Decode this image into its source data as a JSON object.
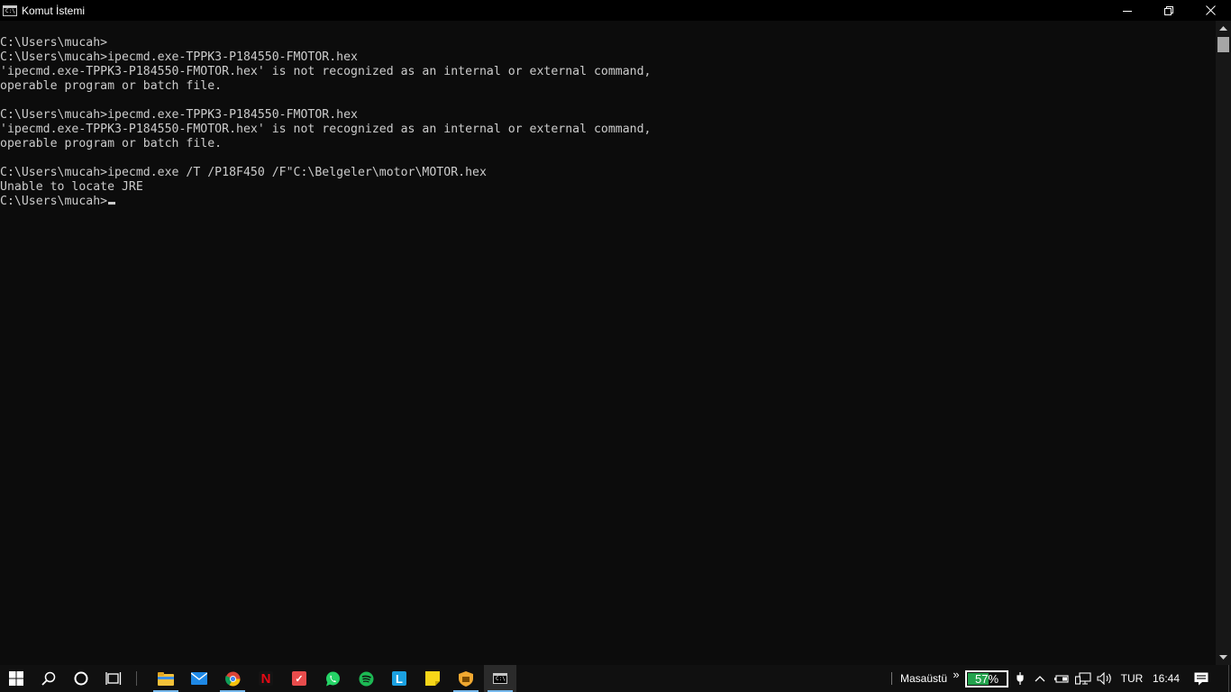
{
  "window": {
    "title": "Komut İstemi",
    "icon_text": "C:\\"
  },
  "console": {
    "lines": [
      "C:\\Users\\mucah>",
      "C:\\Users\\mucah>ipecmd.exe-TPPK3-P184550-FMOTOR.hex",
      "'ipecmd.exe-TPPK3-P184550-FMOTOR.hex' is not recognized as an internal or external command,",
      "operable program or batch file.",
      "",
      "C:\\Users\\mucah>ipecmd.exe-TPPK3-P184550-FMOTOR.hex",
      "'ipecmd.exe-TPPK3-P184550-FMOTOR.hex' is not recognized as an internal or external command,",
      "operable program or batch file.",
      "",
      "C:\\Users\\mucah>ipecmd.exe /T /P18F450 /F\"C:\\Belgeler\\motor\\MOTOR.hex",
      "Unable to locate JRE",
      "C:\\Users\\mucah>"
    ],
    "text_color": "#cccccc",
    "background": "#0c0c0c"
  },
  "taskbar": {
    "apps": [
      {
        "name": "file-explorer",
        "icon": "folder-icon",
        "color": "#f3c13a",
        "glyph": "",
        "running": true
      },
      {
        "name": "mail",
        "icon": "mail-icon",
        "color": "#1e88e5",
        "glyph": "",
        "running": false
      },
      {
        "name": "chrome",
        "icon": "chrome-icon",
        "color": "#4caf50",
        "glyph": "",
        "running": true
      },
      {
        "name": "netflix",
        "icon": "netflix-icon",
        "color": "#e50914",
        "glyph": "N",
        "running": false
      },
      {
        "name": "todo",
        "icon": "checklist-icon",
        "color": "#e84c4c",
        "glyph": "✓",
        "running": false
      },
      {
        "name": "whatsapp",
        "icon": "whatsapp-icon",
        "color": "#25d366",
        "glyph": "",
        "running": false
      },
      {
        "name": "spotify",
        "icon": "spotify-icon",
        "color": "#1db954",
        "glyph": "",
        "running": false
      },
      {
        "name": "l-app",
        "icon": "l-letter-icon",
        "color": "#1ba1e2",
        "glyph": "L",
        "running": false
      },
      {
        "name": "sticky-notes",
        "icon": "sticky-note-icon",
        "color": "#f7d619",
        "glyph": "",
        "running": false
      },
      {
        "name": "shield-app",
        "icon": "shield-icon",
        "color": "#f0a830",
        "glyph": "",
        "running": true
      },
      {
        "name": "command-prompt",
        "icon": "terminal-icon",
        "color": "#2b2b2b",
        "glyph": "C:\\",
        "running": true
      }
    ],
    "desktop_label": "Masaüstü",
    "battery_percent_label": "57%",
    "battery_level": 57,
    "language": "TUR",
    "clock": "16:44"
  }
}
